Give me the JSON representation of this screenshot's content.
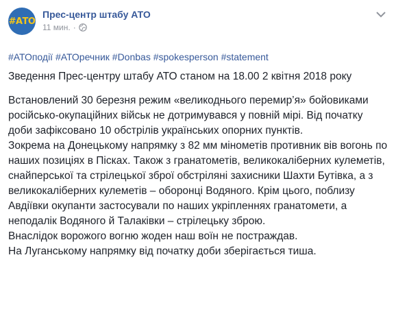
{
  "post": {
    "author": "Прес-центр штабу АТО",
    "avatar_text": "#АТО",
    "timestamp": "11 мин.",
    "separator": "·",
    "privacy_icon": "globe-icon",
    "menu_icon": "chevron-down-icon",
    "hashtags": [
      "#АТОподії",
      "#АТОречник",
      "#Donbas",
      "#spokesperson",
      "#statement"
    ],
    "paragraphs": [
      "Зведення Прес-центру штабу АТО станом на 18.00 2 квітня 2018 року",
      "Встановлений 30 березня режим «великоднього перемир’я» бойовиками російсько-окупаційних військ не дотримувався у повній мірі. Від початку доби зафіксовано 10 обстрілів українських опорних пунктів.",
      "Зокрема на Донецькому напрямку з 82 мм мінометів противник вів вогонь по наших позиціях в Пісках. Також з гранатометів, великокаліберних кулеметів, снайперської та стрілецької зброї обстріляні захисники Шахти Бутівка, а з великокаліберних кулеметів – оборонці Водяного. Крім цього, поблизу Авдіївки окупанти застосували по наших укріпленнях гранатомети, а неподалік Водяного й Талаківки – стрілецьку зброю.",
      "Внаслідок ворожого вогню жоден наш воїн не постраждав.",
      "На Луганському напрямку від початку доби зберігається тиша."
    ]
  },
  "colors": {
    "link": "#365899",
    "meta": "#90949c",
    "text": "#1d2129",
    "avatar_bg": "#2f6db5",
    "avatar_text": "#f5c518"
  }
}
